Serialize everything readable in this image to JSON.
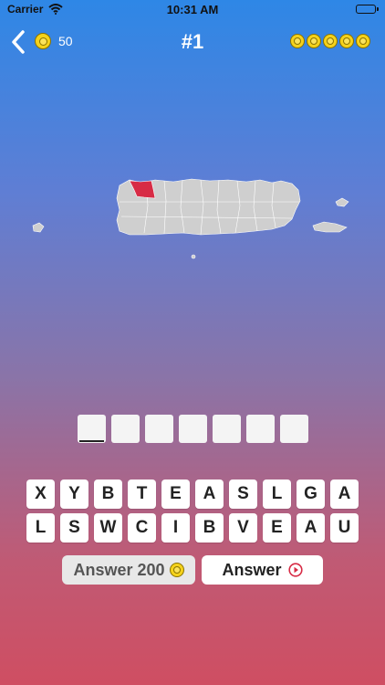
{
  "status_bar": {
    "carrier": "Carrier",
    "time": "10:31 AM"
  },
  "nav": {
    "title": "#1",
    "coins": "50"
  },
  "quiz": {
    "answer_slot_count": 7,
    "keyboard_rows": [
      [
        "X",
        "Y",
        "B",
        "T",
        "E",
        "A",
        "S",
        "L",
        "G",
        "A"
      ],
      [
        "L",
        "S",
        "W",
        "C",
        "I",
        "B",
        "V",
        "E",
        "A",
        "U"
      ]
    ]
  },
  "buttons": {
    "hint_label": "Answer 200",
    "video_label": "Answer"
  },
  "colors": {
    "highlight_region": "#d72b45",
    "map_fill": "#cfcfcf",
    "coin": "#f5d21b"
  }
}
